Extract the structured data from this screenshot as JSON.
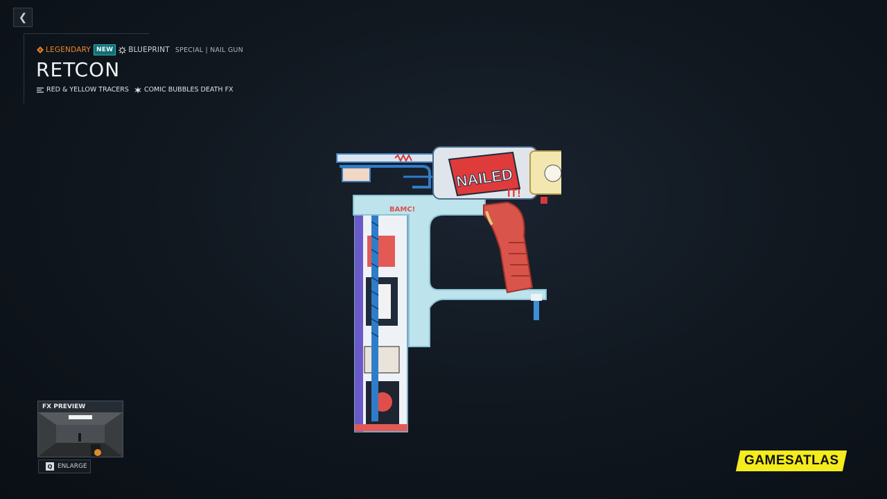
{
  "nav": {
    "back_icon": "chevron-left-icon",
    "back_glyph": "❮"
  },
  "item": {
    "rarity": "LEGENDARY",
    "rarity_color": "#f08a2c",
    "badge": "NEW",
    "type": "BLUEPRINT",
    "category": "SPECIAL | NAIL GUN",
    "name": "RETCON",
    "effects": [
      {
        "icon": "tracer-icon",
        "label": "RED & YELLOW TRACERS"
      },
      {
        "icon": "burst-icon",
        "label": "COMIC BUBBLES DEATH FX"
      }
    ]
  },
  "preview": {
    "label": "FX PREVIEW",
    "key": "Q",
    "action": "ENLARGE"
  },
  "watermark": {
    "text": "GAMESATLAS",
    "color": "#f4ec1c"
  }
}
